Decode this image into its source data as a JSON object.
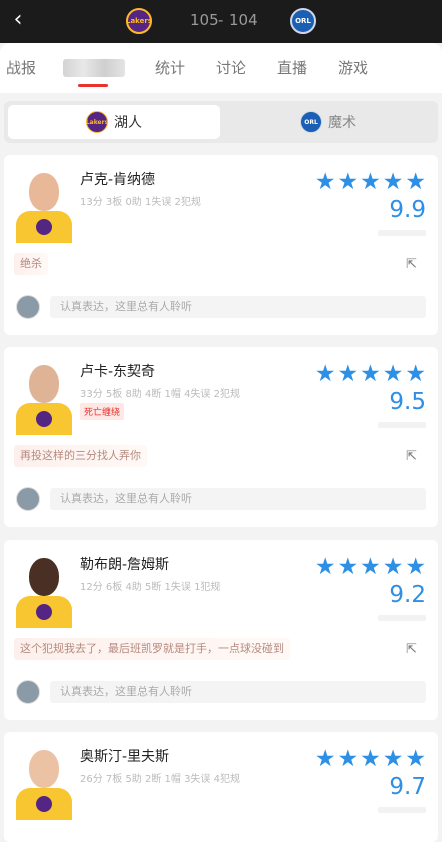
{
  "header": {
    "back_icon": "chevron-left-icon",
    "home_team_logo_text": "Lakers",
    "away_team_logo_text": "ORL",
    "home_score": "105",
    "dash": "-",
    "away_score": "104"
  },
  "tabs": [
    {
      "label": "战报"
    },
    {
      "label": ""
    },
    {
      "label": "统计"
    },
    {
      "label": "讨论"
    },
    {
      "label": "直播"
    },
    {
      "label": "游戏"
    }
  ],
  "team_toggle": {
    "home": {
      "logo_text": "Lakers",
      "label": "湖人"
    },
    "away": {
      "logo_text": "ORL",
      "label": "魔术"
    }
  },
  "comment_placeholder": "认真表达，这里总有人聆听",
  "players": [
    {
      "name": "卢克-肯纳德",
      "stats": "13分 3板 0助 1失误 2犯规",
      "tag": "",
      "rating": "9.9",
      "stars": 5,
      "comment": "绝杀"
    },
    {
      "name": "卢卡-东契奇",
      "stats": "33分 5板 8助 4断 1帽 4失误 2犯规",
      "tag": "死亡缠绕",
      "rating": "9.5",
      "stars": 5,
      "comment": "再投这样的三分找人弄你"
    },
    {
      "name": "勒布朗-詹姆斯",
      "stats": "12分 6板 4助 5断 1失误 1犯规",
      "tag": "",
      "rating": "9.2",
      "stars": 5,
      "comment": "这个犯规我去了，最后班凯罗就是打手，一点球没碰到"
    },
    {
      "name": "奥斯汀-里夫斯",
      "stats": "26分 7板 5助 2断 1帽 3失误 4犯规",
      "tag": "",
      "rating": "9.7",
      "stars": 5,
      "comment": ""
    }
  ],
  "colors": {
    "accent": "#e8322b",
    "rating": "#2d8fe6",
    "header_bg": "#1b1b1b"
  }
}
